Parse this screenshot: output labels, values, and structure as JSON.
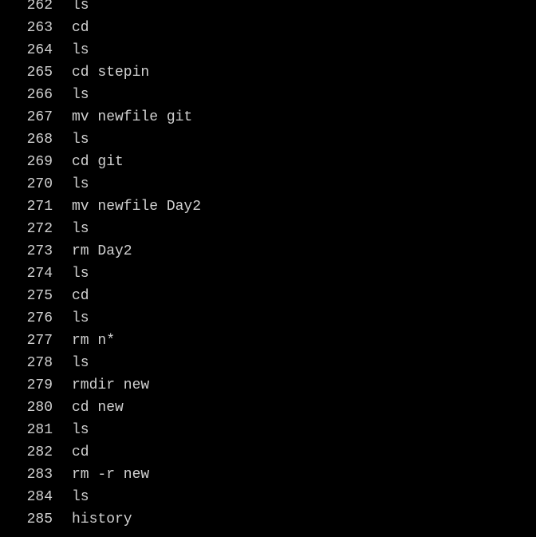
{
  "terminal": {
    "background": "#000000",
    "foreground": "#d0d0d0",
    "history": [
      {
        "num": "262",
        "cmd": "ls"
      },
      {
        "num": "263",
        "cmd": "cd"
      },
      {
        "num": "264",
        "cmd": "ls"
      },
      {
        "num": "265",
        "cmd": "cd stepin"
      },
      {
        "num": "266",
        "cmd": "ls"
      },
      {
        "num": "267",
        "cmd": "mv newfile git"
      },
      {
        "num": "268",
        "cmd": "ls"
      },
      {
        "num": "269",
        "cmd": "cd git"
      },
      {
        "num": "270",
        "cmd": "ls"
      },
      {
        "num": "271",
        "cmd": "mv newfile Day2"
      },
      {
        "num": "272",
        "cmd": "ls"
      },
      {
        "num": "273",
        "cmd": "rm Day2"
      },
      {
        "num": "274",
        "cmd": "ls"
      },
      {
        "num": "275",
        "cmd": "cd"
      },
      {
        "num": "276",
        "cmd": "ls"
      },
      {
        "num": "277",
        "cmd": "rm n*"
      },
      {
        "num": "278",
        "cmd": "ls"
      },
      {
        "num": "279",
        "cmd": "rmdir new"
      },
      {
        "num": "280",
        "cmd": "cd new"
      },
      {
        "num": "281",
        "cmd": "ls"
      },
      {
        "num": "282",
        "cmd": "cd"
      },
      {
        "num": "283",
        "cmd": "rm -r new"
      },
      {
        "num": "284",
        "cmd": "ls"
      },
      {
        "num": "285",
        "cmd": "history"
      }
    ]
  }
}
